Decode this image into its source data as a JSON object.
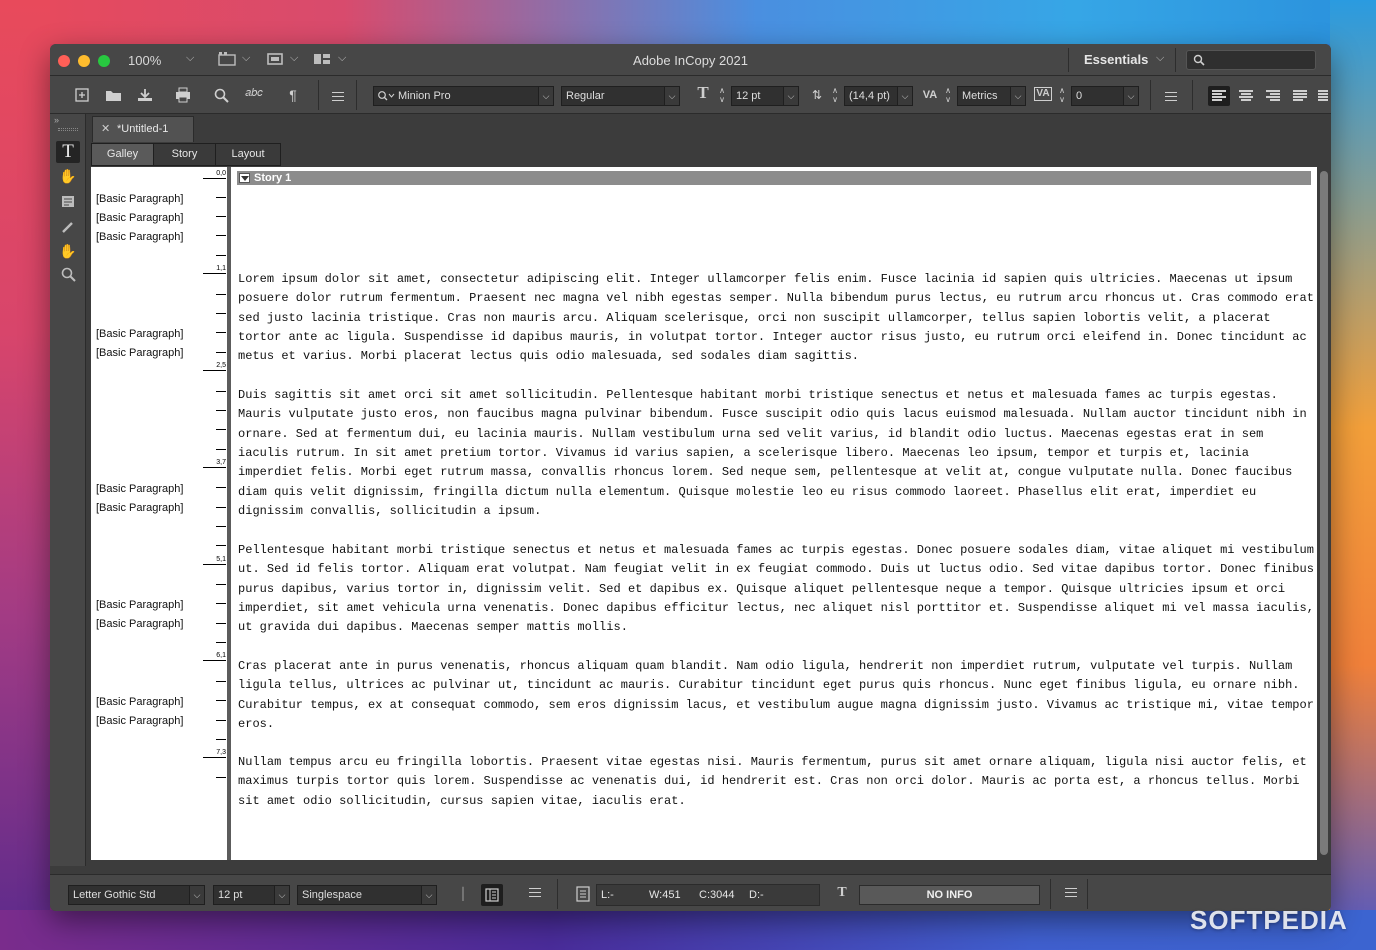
{
  "window": {
    "title": "Adobe InCopy 2021",
    "zoom": "100%",
    "workspace": "Essentials",
    "search_placeholder": ""
  },
  "controlbar": {
    "font_family": "Minion Pro",
    "font_style": "Regular",
    "font_size": "12 pt",
    "leading": "(14,4 pt)",
    "kerning": "Metrics",
    "tracking": "0"
  },
  "document": {
    "tab_title": "*Untitled-1",
    "view_tabs": [
      "Galley",
      "Story",
      "Layout"
    ],
    "story_title": "Story 1",
    "depth_markers": [
      "0,0",
      "1,1",
      "2,5",
      "3,7",
      "5,1",
      "6,1",
      "7,3"
    ],
    "paragraph_style": "[Basic Paragraph]",
    "paragraphs": [
      "Lorem ipsum dolor sit amet, consectetur adipiscing elit. Integer ullamcorper felis enim. Fusce lacinia id sapien quis ultricies. Maecenas ut ipsum posuere dolor rutrum fermentum. Praesent nec magna vel nibh egestas semper. Nulla bibendum purus lectus, eu rutrum arcu rhoncus ut. Cras commodo erat sed justo lacinia tristique. Cras non mauris arcu. Aliquam scelerisque, orci non suscipit ullamcorper, tellus sapien lobortis velit, a placerat tortor ante ac ligula. Suspendisse id dapibus mauris, in volutpat tortor. Integer auctor risus justo, eu rutrum orci eleifend in. Donec tincidunt ac metus et varius. Morbi placerat lectus quis odio malesuada, sed sodales diam sagittis.",
      "Duis sagittis sit amet orci sit amet sollicitudin. Pellentesque habitant morbi tristique senectus et netus et malesuada fames ac turpis egestas. Mauris vulputate justo eros, non faucibus magna pulvinar bibendum. Fusce suscipit odio quis lacus euismod malesuada. Nullam auctor tincidunt nibh in ornare. Sed at fermentum dui, eu lacinia mauris. Nullam vestibulum urna sed velit varius, id blandit odio luctus. Maecenas egestas erat in sem iaculis rutrum. In sit amet pretium tortor. Vivamus id varius sapien, a scelerisque libero. Maecenas leo ipsum, tempor et turpis et, lacinia imperdiet felis. Morbi eget rutrum massa, convallis rhoncus lorem. Sed neque sem, pellentesque at velit at, congue vulputate nulla. Donec faucibus diam quis velit dignissim, fringilla dictum nulla elementum. Quisque molestie leo eu risus commodo laoreet. Phasellus elit erat, imperdiet eu dignissim convallis, sollicitudin a ipsum.",
      "Pellentesque habitant morbi tristique senectus et netus et malesuada fames ac turpis egestas. Donec posuere sodales diam, vitae aliquet mi vestibulum ut. Sed id felis tortor. Aliquam erat volutpat. Nam feugiat velit in ex feugiat commodo. Duis ut luctus odio. Sed vitae dapibus tortor. Donec finibus purus dapibus, varius tortor in, dignissim velit. Sed et dapibus ex. Quisque aliquet pellentesque neque a tempor. Quisque ultricies ipsum et orci imperdiet, sit amet vehicula urna venenatis. Donec dapibus efficitur lectus, nec aliquet nisl porttitor et. Suspendisse aliquet mi vel massa iaculis, ut gravida dui dapibus. Maecenas semper mattis mollis.",
      "Cras placerat ante in purus venenatis, rhoncus aliquam quam blandit. Nam odio ligula, hendrerit non imperdiet rutrum, vulputate vel turpis. Nullam ligula tellus, ultrices ac pulvinar ut, tincidunt ac mauris. Curabitur tincidunt eget purus quis rhoncus. Nunc eget finibus ligula, eu ornare nibh. Curabitur tempus, ex at consequat commodo, sem eros dignissim lacus, et vestibulum augue magna dignissim justo. Vivamus ac tristique mi, vitae tempor eros.",
      "Nullam tempus arcu eu fringilla lobortis. Praesent vitae egestas nisi. Mauris fermentum, purus sit amet ornare aliquam, ligula nisi auctor felis, et maximus turpis tortor quis lorem. Suspendisse ac venenatis dui, id hendrerit est. Cras non orci dolor. Mauris ac porta est, a rhoncus tellus. Morbi sit amet odio sollicitudin, cursus sapien vitae, iaculis erat."
    ]
  },
  "statusbar": {
    "font_family": "Letter Gothic Std",
    "font_size": "12 pt",
    "spacing": "Singlespace",
    "line": "L:-",
    "words": "W:451",
    "chars": "C:3044",
    "depth": "D:-",
    "info": "NO INFO"
  },
  "watermark": "SOFTPEDIA",
  "colors": {
    "window_bg": "#3c3c3c",
    "panel_bg": "#474747",
    "story_header": "#8c8c8c"
  }
}
